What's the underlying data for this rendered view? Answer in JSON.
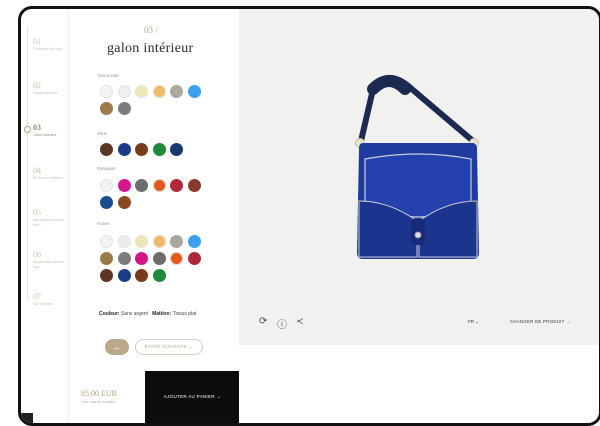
{
  "steps": [
    {
      "num": "01",
      "label": "Cabochon de logo"
    },
    {
      "num": "02",
      "label": "Galon extérieur"
    },
    {
      "num": "03",
      "label": "Galon intérieur"
    },
    {
      "num": "04",
      "label": "Bi-Galons Intérieur"
    },
    {
      "num": "05",
      "label": "Bandoulière double bois"
    },
    {
      "num": "06",
      "label": "Bandoulière double logo"
    },
    {
      "num": "07",
      "label": "Sac Intérieur"
    }
  ],
  "active_step": 2,
  "panel": {
    "step_number": "03 /",
    "title": "galon intérieur",
    "groups": [
      {
        "label": "Tissus plat",
        "colors": [
          "#f4f4f2",
          "#efefed",
          "#ece6b8",
          "#f0b968",
          "#a9a9a2",
          "#3aa0f0",
          "#9b7b4a",
          "#7c7c7c"
        ]
      },
      {
        "label": "Verni",
        "colors": [
          "#5e3627",
          "#1c3c8a",
          "#7a3b1d",
          "#1f8a3a",
          "#183a6e"
        ]
      },
      {
        "label": "Paraquet",
        "colors": [
          "#f2f2f0",
          "#d4168c",
          "#6e6e6e",
          "#e25a1b",
          "#b0283a",
          "#8a3a2b",
          "#1d4a8f",
          "#8a4a21"
        ]
      },
      {
        "label": "Fusee",
        "colors": [
          "#f3f3f1",
          "#ececea",
          "#eee6b4",
          "#efb866",
          "#a7a7a0",
          "#3aa0ef",
          "#9b7a48",
          "#7b7b7b",
          "#d4168b",
          "#6d6d6d",
          "#e15a1c",
          "#ae2739",
          "#5e3626",
          "#1c3c8a",
          "#7a3b1d",
          "#1f8a3a"
        ]
      }
    ],
    "selection": {
      "couleur_key": "Couleur:",
      "couleur_value": "Sans argent",
      "matiere_key": "Matière:",
      "matiere_value": "Tissus plat"
    },
    "prev_label": "←",
    "next_label": "ÉTAPE SUIVANTE →"
  },
  "footer": {
    "price": "85,00 EUR",
    "price_note": "Hors frais de livraison",
    "cart_label": "AJOUTER AU PANIER →"
  },
  "preview": {
    "icons": [
      "rotate-icon",
      "info-icon",
      "share-icon"
    ],
    "lang_label": "FR ⌄",
    "change_label": "CHANGER DE PRODUIT →",
    "bag_color": "#1f3ba0"
  }
}
